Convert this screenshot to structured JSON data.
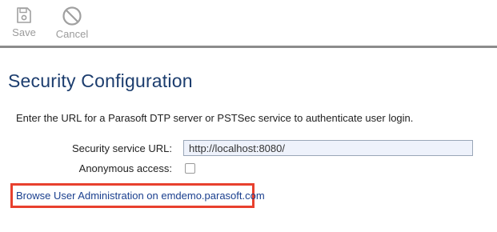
{
  "toolbar": {
    "save_label": "Save",
    "cancel_label": "Cancel",
    "save_icon": "floppy-disk-icon",
    "cancel_icon": "cancel-circle-icon",
    "disabled_color": "#9b9b9b"
  },
  "page": {
    "title": "Security Configuration",
    "description": "Enter the URL for a Parasoft DTP server or PSTSec service to authenticate user login."
  },
  "form": {
    "url_label": "Security service URL:",
    "url_value": "http://localhost:8080/",
    "anonymous_label": "Anonymous access:",
    "anonymous_checked": false
  },
  "links": {
    "browse_admin": "Browse User Administration on emdemo.parasoft.com"
  },
  "colors": {
    "title": "#1c3d6e",
    "link": "#1a3f8e",
    "highlight_border": "#e8402e",
    "input_background": "#eef2fb"
  }
}
